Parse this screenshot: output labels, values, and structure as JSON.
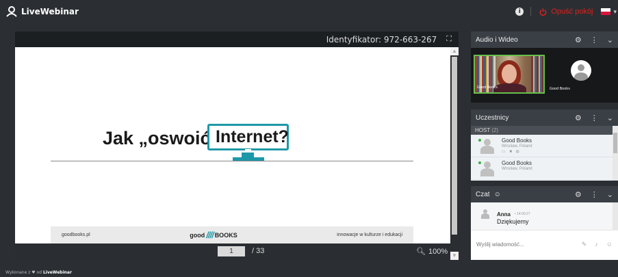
{
  "header": {
    "logo_text": "LiveWebinar",
    "leave_label": "Opuść pokój",
    "flag_colors": [
      "#ffffff",
      "#dc143c"
    ]
  },
  "presentation": {
    "identifier": "Identyfikator: 972-663-267",
    "slide": {
      "title_part1": "Jak „oswoić”",
      "title_part2": "Internet?",
      "footer_left": "goodbooks.pl",
      "footer_brand_prefix": "good",
      "footer_brand_suffix": "BOOKS",
      "footer_right": "innowacje w kulturze i edukacji"
    },
    "current_page": "1",
    "total_pages": "/ 33",
    "zoom": "100%"
  },
  "audio_video": {
    "title": "Audio i Wideo",
    "tiles": [
      {
        "label": "Good Books"
      },
      {
        "label": "Good Books"
      }
    ]
  },
  "participants": {
    "title": "Uczestnicy",
    "host_label": "HOST",
    "host_count": "(2)",
    "users": [
      {
        "name": "Good Books",
        "location": "Wrocław, Poland"
      },
      {
        "name": "Good Books",
        "location": "Wrocław, Poland"
      }
    ]
  },
  "chat": {
    "title": "Czat",
    "messages": [
      {
        "author": "Anna",
        "time": "• 14:00:27",
        "text": "Dziękujemy"
      }
    ],
    "input_placeholder": "Wyślij wiadomość..."
  },
  "footer": {
    "made_with": "Wykonane z ♥ od",
    "brand": "LiveWebinar"
  },
  "colors": {
    "accent": "#1e98a8",
    "leave_red": "#e0201c",
    "active_video_border": "#67c04b"
  }
}
